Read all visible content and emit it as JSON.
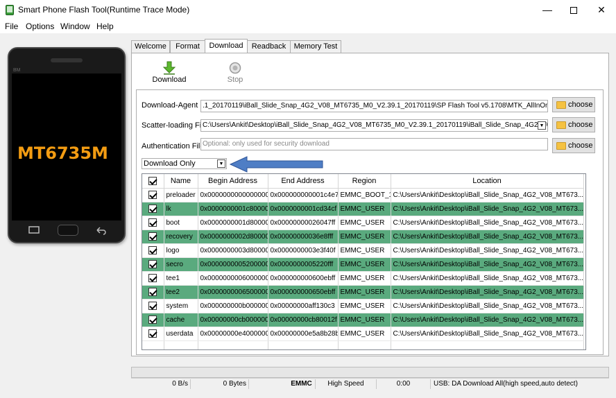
{
  "window": {
    "title": "Smart Phone Flash Tool(Runtime Trace Mode)"
  },
  "menu": [
    "File",
    "Options",
    "Window",
    "Help"
  ],
  "phone": {
    "model_text": "MT6735M",
    "brand_mark": "BM"
  },
  "tabs": [
    "Welcome",
    "Format",
    "Download",
    "Readback",
    "Memory Test"
  ],
  "toolbar": {
    "download_label": "Download",
    "stop_label": "Stop"
  },
  "fields": {
    "download_agent": {
      "label": "Download-Agent",
      "value": ".1_20170119\\iBall_Slide_Snap_4G2_V08_MT6735_M0_V2.39.1_20170119\\SP Flash Tool v5.1708\\MTK_AllInOne_DA.bin"
    },
    "scatter": {
      "label": "Scatter-loading File",
      "value": "C:\\Users\\Ankit\\Desktop\\iBall_Slide_Snap_4G2_V08_MT6735_M0_V2.39.1_20170119\\iBall_Slide_Snap_4G2_V08_MT6"
    },
    "auth": {
      "label": "Authentication File",
      "placeholder": "Optional: only used for security download"
    },
    "choose_label": "choose",
    "mode": "Download Only"
  },
  "table": {
    "headers": [
      "Name",
      "Begin Address",
      "End Address",
      "Region",
      "Location"
    ],
    "rows": [
      {
        "name": "preloader",
        "begin": "0x0000000000000000",
        "end": "0x000000000001c4e7",
        "region": "EMMC_BOOT_1",
        "location": "C:\\Users\\Ankit\\Desktop\\iBall_Slide_Snap_4G2_V08_MT673..."
      },
      {
        "name": "lk",
        "begin": "0x0000000001c80000",
        "end": "0x0000000001cd34cf",
        "region": "EMMC_USER",
        "location": "C:\\Users\\Ankit\\Desktop\\iBall_Slide_Snap_4G2_V08_MT673..."
      },
      {
        "name": "boot",
        "begin": "0x0000000001d80000",
        "end": "0x00000000026047ff",
        "region": "EMMC_USER",
        "location": "C:\\Users\\Ankit\\Desktop\\iBall_Slide_Snap_4G2_V08_MT673..."
      },
      {
        "name": "recovery",
        "begin": "0x0000000002d80000",
        "end": "0x00000000036e8fff",
        "region": "EMMC_USER",
        "location": "C:\\Users\\Ankit\\Desktop\\iBall_Slide_Snap_4G2_V08_MT673..."
      },
      {
        "name": "logo",
        "begin": "0x0000000003d80000",
        "end": "0x0000000003e3f40f",
        "region": "EMMC_USER",
        "location": "C:\\Users\\Ankit\\Desktop\\iBall_Slide_Snap_4G2_V08_MT673..."
      },
      {
        "name": "secro",
        "begin": "0x0000000005200000",
        "end": "0x0000000005220fff",
        "region": "EMMC_USER",
        "location": "C:\\Users\\Ankit\\Desktop\\iBall_Slide_Snap_4G2_V08_MT673..."
      },
      {
        "name": "tee1",
        "begin": "0x0000000006000000",
        "end": "0x000000000600ebff",
        "region": "EMMC_USER",
        "location": "C:\\Users\\Ankit\\Desktop\\iBall_Slide_Snap_4G2_V08_MT673..."
      },
      {
        "name": "tee2",
        "begin": "0x0000000006500000",
        "end": "0x000000000650ebff",
        "region": "EMMC_USER",
        "location": "C:\\Users\\Ankit\\Desktop\\iBall_Slide_Snap_4G2_V08_MT673..."
      },
      {
        "name": "system",
        "begin": "0x000000000b000000",
        "end": "0x00000000aff130c3",
        "region": "EMMC_USER",
        "location": "C:\\Users\\Ankit\\Desktop\\iBall_Slide_Snap_4G2_V08_MT673..."
      },
      {
        "name": "cache",
        "begin": "0x00000000cb000000",
        "end": "0x00000000cb80012f",
        "region": "EMMC_USER",
        "location": "C:\\Users\\Ankit\\Desktop\\iBall_Slide_Snap_4G2_V08_MT673..."
      },
      {
        "name": "userdata",
        "begin": "0x00000000e4000000",
        "end": "0x00000000e5a8b28b",
        "region": "EMMC_USER",
        "location": "C:\\Users\\Ankit\\Desktop\\iBall_Slide_Snap_4G2_V08_MT673..."
      }
    ]
  },
  "status": {
    "speed": "0 B/s",
    "bytes": "0 Bytes",
    "storage": "EMMC",
    "mode": "High Speed",
    "time": "0:00",
    "usb": "USB: DA Download All(high speed,auto detect)"
  },
  "colors": {
    "highlight_row": "#5aaa7e",
    "arrow": "#4f7ec5",
    "phone_text": "#f39c12"
  }
}
